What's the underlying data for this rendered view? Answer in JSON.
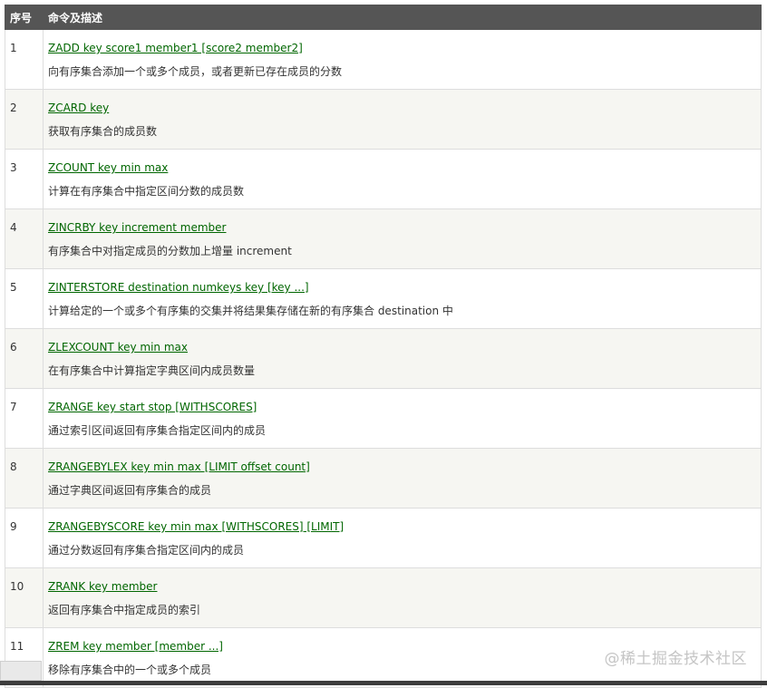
{
  "header": {
    "num": "序号",
    "cmd": "命令及描述"
  },
  "rows": [
    {
      "num": "1",
      "cmd": "ZADD key score1 member1 [score2 member2]",
      "desc": "向有序集合添加一个或多个成员，或者更新已存在成员的分数"
    },
    {
      "num": "2",
      "cmd": "ZCARD key",
      "desc": "获取有序集合的成员数"
    },
    {
      "num": "3",
      "cmd": "ZCOUNT key min max",
      "desc": "计算在有序集合中指定区间分数的成员数"
    },
    {
      "num": "4",
      "cmd": "ZINCRBY key increment member",
      "desc": "有序集合中对指定成员的分数加上增量 increment"
    },
    {
      "num": "5",
      "cmd": "ZINTERSTORE destination numkeys key [key ...]",
      "desc": "计算给定的一个或多个有序集的交集并将结果集存储在新的有序集合 destination 中"
    },
    {
      "num": "6",
      "cmd": "ZLEXCOUNT key min max",
      "desc": "在有序集合中计算指定字典区间内成员数量"
    },
    {
      "num": "7",
      "cmd": "ZRANGE key start stop [WITHSCORES]",
      "desc": "通过索引区间返回有序集合指定区间内的成员"
    },
    {
      "num": "8",
      "cmd": "ZRANGEBYLEX key min max [LIMIT offset count]",
      "desc": "通过字典区间返回有序集合的成员"
    },
    {
      "num": "9",
      "cmd": "ZRANGEBYSCORE key min max [WITHSCORES] [LIMIT]",
      "desc": "通过分数返回有序集合指定区间内的成员"
    },
    {
      "num": "10",
      "cmd": "ZRANK key member",
      "desc": "返回有序集合中指定成员的索引"
    },
    {
      "num": "11",
      "cmd": "ZREM key member [member ...]",
      "desc": "移除有序集合中的一个或多个成员"
    }
  ],
  "watermark": "@稀土掘金技术社区"
}
